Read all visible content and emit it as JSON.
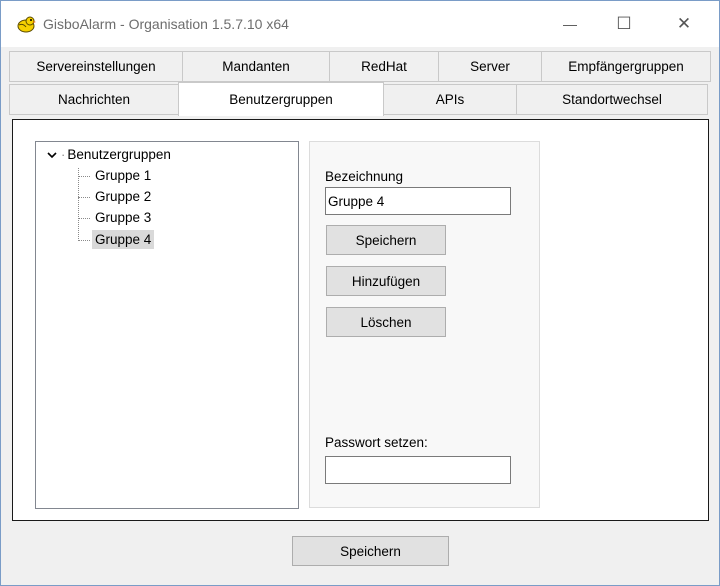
{
  "window": {
    "title": "GisboAlarm - Organisation 1.5.7.10 x64",
    "minimize_glyph": "—",
    "maximize_glyph": "☐",
    "close_glyph": "✕"
  },
  "tabs": {
    "row1": [
      "Servereinstellungen",
      "Mandanten",
      "RedHat",
      "Server",
      "Empfängergruppen"
    ],
    "row2": [
      "Nachrichten",
      "Benutzergruppen",
      "APIs",
      "Standortwechsel"
    ],
    "active": "Benutzergruppen"
  },
  "tree": {
    "root_label": "Benutzergruppen",
    "items": [
      "Gruppe 1",
      "Gruppe 2",
      "Gruppe 3",
      "Gruppe 4"
    ],
    "selected": "Gruppe 4"
  },
  "form": {
    "bezeichnung_label": "Bezeichnung",
    "bezeichnung_value": "Gruppe 4",
    "speichern_label": "Speichern",
    "hinzufuegen_label": "Hinzufügen",
    "loeschen_label": "Löschen",
    "passwort_label": "Passwort setzen:",
    "passwort_value": ""
  },
  "footer": {
    "speichern_label": "Speichern"
  },
  "icons": {
    "app": "bird-app-icon",
    "expand": "chevron-down-icon"
  },
  "colors": {
    "selection": "#d9d9d9",
    "button_bg": "#e1e1e1",
    "panel_border": "#1a1a1a"
  }
}
